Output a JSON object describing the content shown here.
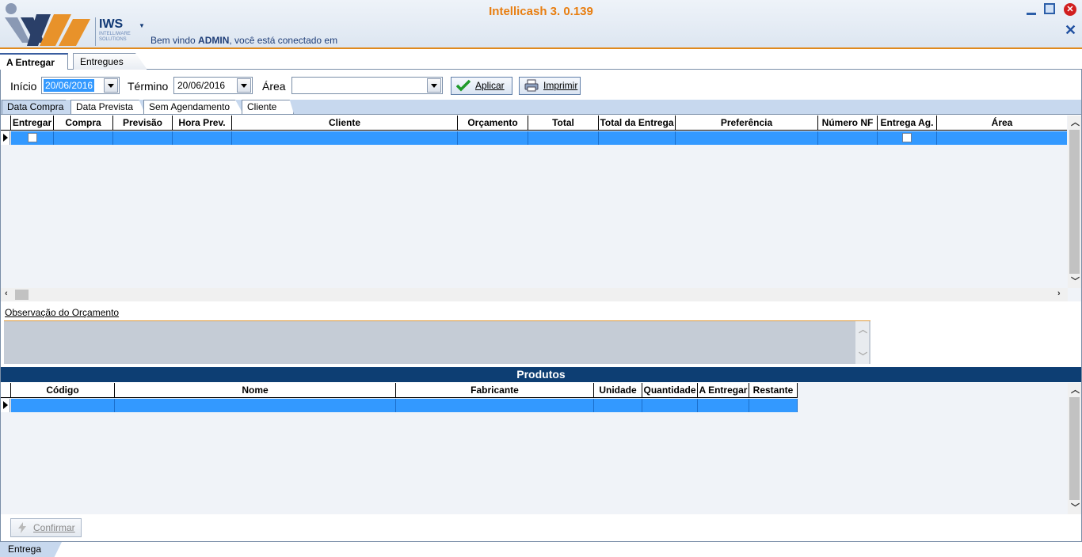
{
  "header": {
    "app_title": "Intellicash 3. 0.139",
    "logo_name": "IWS",
    "logo_subtitle_1": "INTELLIWARE",
    "logo_subtitle_2": "SOLUTIONS",
    "welcome_prefix": "Bem vindo ",
    "welcome_user": "ADMIN",
    "welcome_suffix": ", você está conectado em"
  },
  "top_tabs": [
    {
      "label": "A Entregar",
      "active": true
    },
    {
      "label": "Entregues",
      "active": false
    }
  ],
  "filters": {
    "inicio_label": "Início",
    "inicio_value": "20/06/2016",
    "termino_label": "Término",
    "termino_value": "20/06/2016",
    "area_label": "Área",
    "area_value": "",
    "aplicar_label": "Aplicar",
    "imprimir_label": "Imprimir"
  },
  "sub_tabs": [
    {
      "label": "Data Compra",
      "active": true
    },
    {
      "label": "Data Prevista",
      "active": false
    },
    {
      "label": "Sem Agendamento",
      "active": false
    },
    {
      "label": "Cliente",
      "active": false
    }
  ],
  "orders_grid": {
    "columns": [
      "Entregar",
      "Compra",
      "Previsão",
      "Hora Prev.",
      "Cliente",
      "Orçamento",
      "Total",
      "Total da Entrega",
      "Preferência",
      "Número NF",
      "Entrega Ag.",
      "Área"
    ],
    "rows": [
      {
        "entregar": false,
        "compra": "",
        "previsao": "",
        "hora_prev": "",
        "cliente": "",
        "orcamento": "",
        "total": "",
        "total_entrega": "",
        "preferencia": "",
        "numero_nf": "",
        "entrega_ag": false,
        "area": "",
        "selected": true
      }
    ]
  },
  "observacao": {
    "label": "Observação do Orçamento",
    "value": ""
  },
  "produtos": {
    "title": "Produtos",
    "columns": [
      "Código",
      "Nome",
      "Fabricante",
      "Unidade",
      "Quantidade",
      "A Entregar",
      "Restante"
    ],
    "rows": [
      {
        "codigo": "",
        "nome": "",
        "fabricante": "",
        "unidade": "",
        "quantidade": "",
        "a_entregar": "",
        "restante": "",
        "selected": true
      }
    ]
  },
  "confirmar_label": "Confirmar",
  "bottom_tabs": [
    {
      "label": "Entrega",
      "active": true
    }
  ],
  "colors": {
    "accent_orange": "#e87e10",
    "selection_blue": "#3399ff",
    "produtos_bar": "#0d3e73",
    "tab_blue": "#c7d8ee"
  }
}
